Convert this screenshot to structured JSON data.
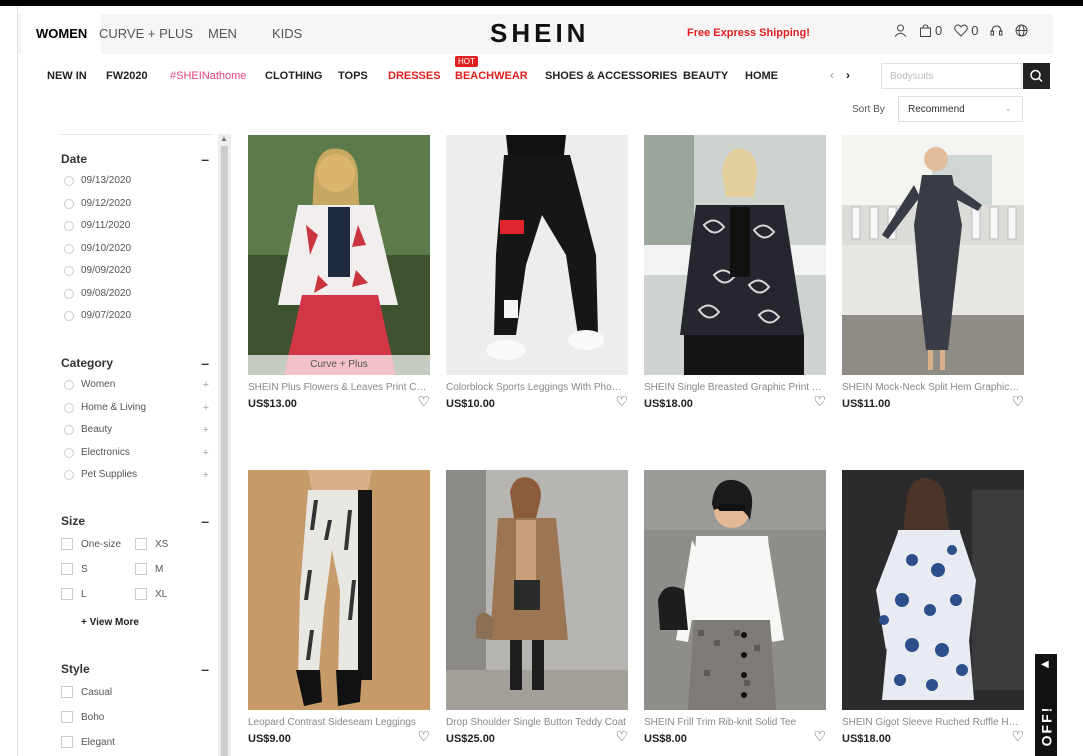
{
  "header": {
    "tabs": [
      {
        "label": "WOMEN",
        "active": true
      },
      {
        "label": "CURVE + PLUS",
        "active": false
      },
      {
        "label": "MEN",
        "active": false
      },
      {
        "label": "KIDS",
        "active": false
      }
    ],
    "logo": "SHEIN",
    "shipping": "Free Express Shipping!",
    "bag_count": "0",
    "wish_count": "0"
  },
  "nav": {
    "items": [
      "NEW IN",
      "FW2020",
      "#SHEINathome",
      "CLOTHING",
      "TOPS",
      "DRESSES",
      "BEACHWEAR",
      "SHOES & ACCESSORIES",
      "BEAUTY",
      "HOME"
    ],
    "hot_badge": "HOT",
    "search_placeholder": "Bodysuits"
  },
  "sort": {
    "label": "Sort By",
    "value": "Recommend"
  },
  "filters": {
    "date": {
      "title": "Date",
      "options": [
        "09/13/2020",
        "09/12/2020",
        "09/11/2020",
        "09/10/2020",
        "09/09/2020",
        "09/08/2020",
        "09/07/2020"
      ]
    },
    "category": {
      "title": "Category",
      "options": [
        "Women",
        "Home & Living",
        "Beauty",
        "Electronics",
        "Pet Supplies"
      ]
    },
    "size": {
      "title": "Size",
      "options": [
        "One-size",
        "XS",
        "S",
        "M",
        "L",
        "XL"
      ],
      "view_more": "+ View More"
    },
    "style": {
      "title": "Style",
      "options": [
        "Casual",
        "Boho",
        "Elegant"
      ]
    }
  },
  "products": [
    {
      "title": "SHEIN Plus Flowers & Leaves Print Collarless Jacket",
      "price": "US$13.00",
      "tag": "Curve + Plus"
    },
    {
      "title": "Colorblock Sports Leggings With Phone Pocket",
      "price": "US$10.00",
      "tag": ""
    },
    {
      "title": "SHEIN Single Breasted Graphic Print Tweed Jacket",
      "price": "US$18.00",
      "tag": ""
    },
    {
      "title": "SHEIN Mock-Neck Split Hem Graphic Dress",
      "price": "US$11.00",
      "tag": ""
    },
    {
      "title": "Leopard Contrast Sideseam Leggings",
      "price": "US$9.00",
      "tag": ""
    },
    {
      "title": "Drop Shoulder Single Button Teddy Coat",
      "price": "US$25.00",
      "tag": ""
    },
    {
      "title": "SHEIN Frill Trim Rib-knit Solid Tee",
      "price": "US$8.00",
      "tag": ""
    },
    {
      "title": "SHEIN Gigot Sleeve Ruched Ruffle Hem Dress",
      "price": "US$18.00",
      "tag": ""
    }
  ],
  "off_tab": "OFF!",
  "colors": {
    "accent_red": "#e02020",
    "pink": "#e0457b",
    "dark": "#222222"
  }
}
